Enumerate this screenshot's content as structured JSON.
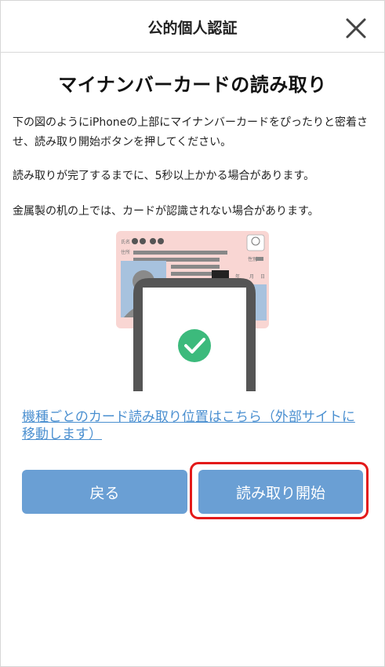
{
  "header": {
    "title": "公的個人認証",
    "close_icon": "close-icon"
  },
  "main": {
    "title": "マイナンバーカードの読み取り",
    "paragraph1": "下の図のようにiPhoneの上部にマイナンバーカードをぴったりと密着させ、読み取り開始ボタンを押してください。",
    "paragraph2": "読み取りが完了するまでに、5秒以上かかる場合があります。",
    "paragraph3": "金属製の机の上では、カードが認識されない場合があります。",
    "illustration": {
      "card_icon": "my-number-card-icon",
      "phone_icon": "smartphone-icon",
      "check_icon": "checkmark-circle-icon",
      "card_color": "#f9d6d3",
      "phone_color": "#555555",
      "check_color": "#3cba7c"
    },
    "link_text": "機種ごとのカード読み取り位置はこちら（外部サイトに移動します）"
  },
  "buttons": {
    "back_label": "戻る",
    "start_label": "読み取り開始"
  },
  "colors": {
    "button_bg": "#6a9fd4",
    "link": "#4a8fd0",
    "highlight": "#e31a1a"
  }
}
